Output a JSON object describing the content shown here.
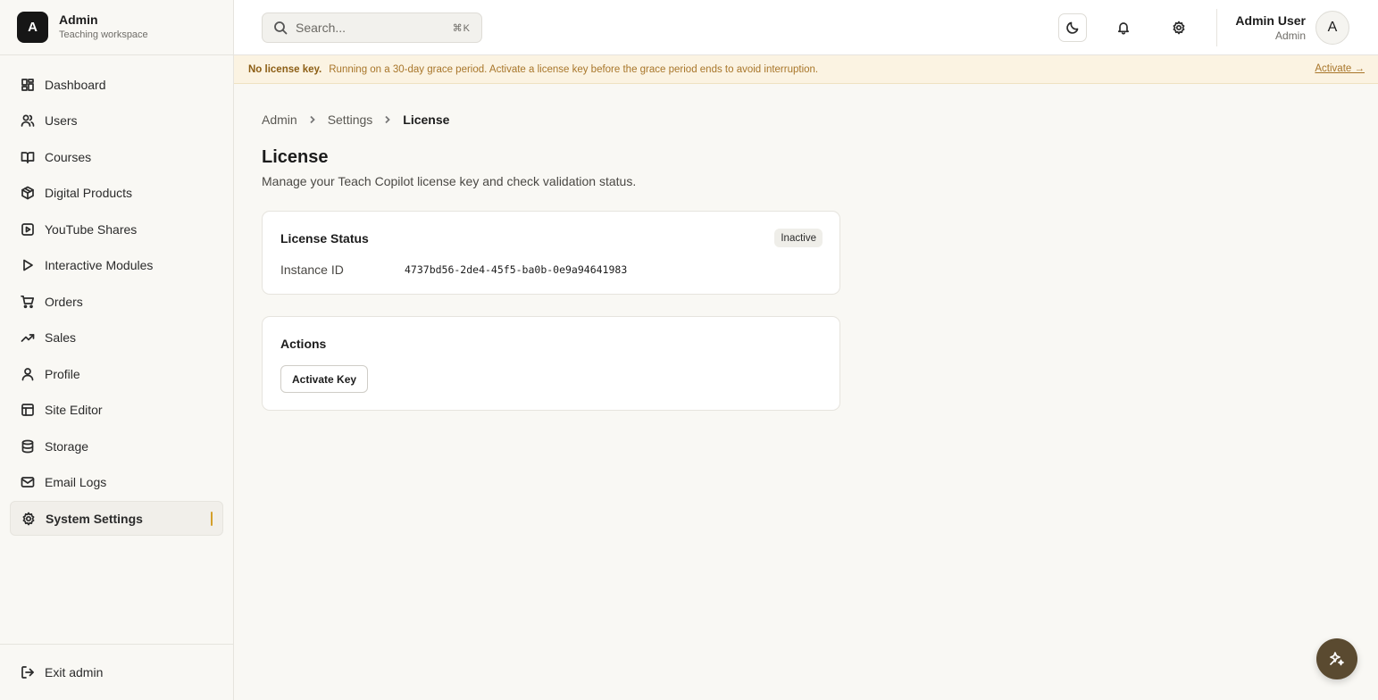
{
  "brand": {
    "logo_letter": "A",
    "title": "Admin",
    "subtitle": "Teaching workspace"
  },
  "sidebar": {
    "items": [
      {
        "label": "Dashboard",
        "icon": "dashboard-icon"
      },
      {
        "label": "Users",
        "icon": "users-icon"
      },
      {
        "label": "Courses",
        "icon": "book-icon"
      },
      {
        "label": "Digital Products",
        "icon": "package-icon"
      },
      {
        "label": "YouTube Shares",
        "icon": "video-icon"
      },
      {
        "label": "Interactive Modules",
        "icon": "play-icon"
      },
      {
        "label": "Orders",
        "icon": "cart-icon"
      },
      {
        "label": "Sales",
        "icon": "trending-up-icon"
      },
      {
        "label": "Profile",
        "icon": "user-icon"
      },
      {
        "label": "Site Editor",
        "icon": "layout-icon"
      },
      {
        "label": "Storage",
        "icon": "database-icon"
      },
      {
        "label": "Email Logs",
        "icon": "mail-icon"
      },
      {
        "label": "System Settings",
        "icon": "gear-icon",
        "active": true
      }
    ],
    "exit_label": "Exit admin"
  },
  "header": {
    "search_placeholder": "Search...",
    "search_shortcut": "⌘K",
    "user_name": "Admin User",
    "user_role": "Admin",
    "avatar_letter": "A"
  },
  "banner": {
    "strong": "No license key.",
    "text": "Running on a 30-day grace period. Activate a license key before the grace period ends to avoid interruption.",
    "link": "Activate →"
  },
  "breadcrumb": [
    "Admin",
    "Settings",
    "License"
  ],
  "page": {
    "title": "License",
    "description": "Manage your Teach Copilot license key and check validation status."
  },
  "status_card": {
    "title": "License Status",
    "badge": "Inactive",
    "instance_label": "Instance ID",
    "instance_value": "4737bd56-2de4-45f5-ba0b-0e9a94641983"
  },
  "actions_card": {
    "title": "Actions",
    "button": "Activate Key"
  },
  "colors": {
    "accent": "#d4a02b",
    "banner_bg": "#fbf3e2",
    "fab": "#5a4a30"
  }
}
